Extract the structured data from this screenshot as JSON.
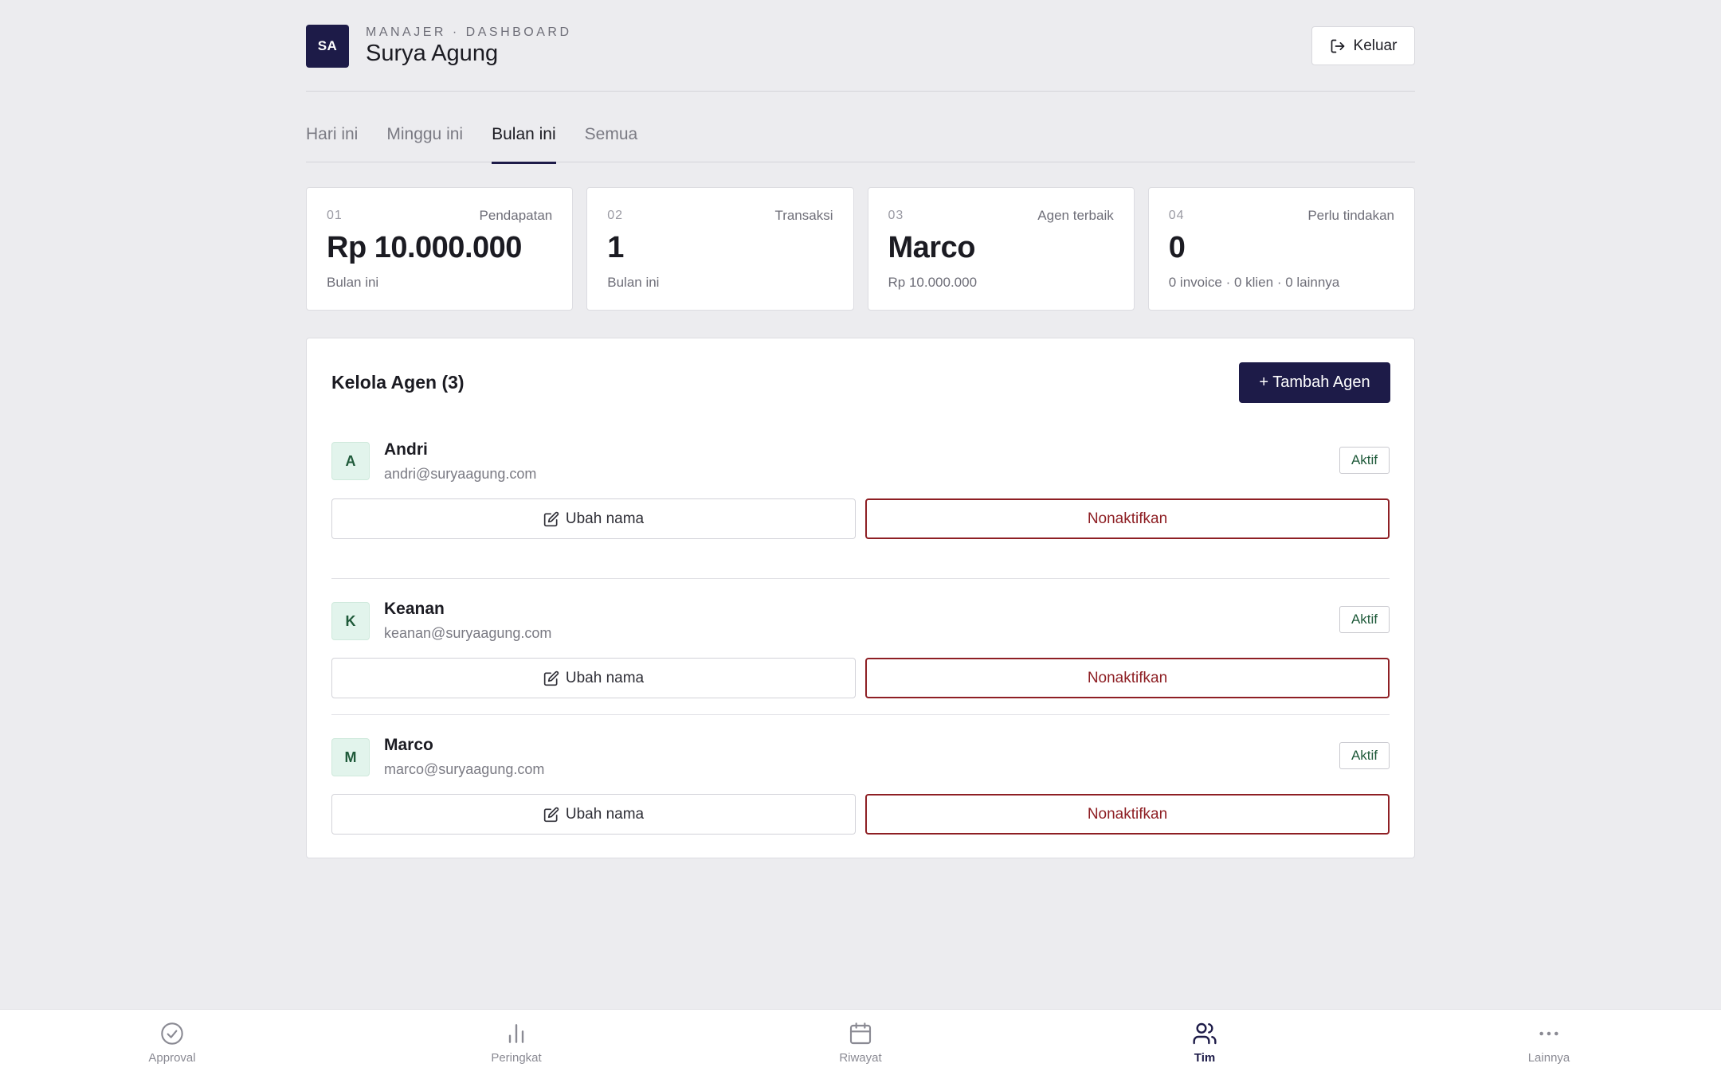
{
  "header": {
    "avatar_initials": "SA",
    "eyebrow": "MANAJER · DASHBOARD",
    "title": "Surya Agung",
    "logout_label": "Keluar",
    "logout_icon": "logout-icon"
  },
  "tabs": [
    {
      "label": "Hari ini",
      "active": false
    },
    {
      "label": "Minggu ini",
      "active": false
    },
    {
      "label": "Bulan ini",
      "active": true
    },
    {
      "label": "Semua",
      "active": false
    }
  ],
  "stats": [
    {
      "num": "01",
      "label": "Pendapatan",
      "value": "Rp 10.000.000",
      "sub": "Bulan ini"
    },
    {
      "num": "02",
      "label": "Transaksi",
      "value": "1",
      "sub": "Bulan ini"
    },
    {
      "num": "03",
      "label": "Agen terbaik",
      "value": "Marco",
      "sub": "Rp 10.000.000"
    },
    {
      "num": "04",
      "label": "Perlu tindakan",
      "value": "0",
      "sub": "0 invoice · 0 klien · 0 lainnya"
    }
  ],
  "agents_panel": {
    "title": "Kelola Agen (3)",
    "add_label": "+ Tambah Agen",
    "edit_label": "Ubah nama",
    "deactivate_label": "Nonaktifkan",
    "agents": [
      {
        "initial": "A",
        "name": "Andri",
        "email": "andri@suryaagung.com",
        "status": "Aktif"
      },
      {
        "initial": "K",
        "name": "Keanan",
        "email": "keanan@suryaagung.com",
        "status": "Aktif"
      },
      {
        "initial": "M",
        "name": "Marco",
        "email": "marco@suryaagung.com",
        "status": "Aktif"
      }
    ]
  },
  "bottom_nav": [
    {
      "label": "Approval",
      "icon": "check-circle-icon",
      "active": false
    },
    {
      "label": "Peringkat",
      "icon": "bar-chart-icon",
      "active": false
    },
    {
      "label": "Riwayat",
      "icon": "calendar-icon",
      "active": false
    },
    {
      "label": "Tim",
      "icon": "users-icon",
      "active": true
    },
    {
      "label": "Lainnya",
      "icon": "more-horizontal-icon",
      "active": false
    }
  ],
  "colors": {
    "background": "#ececef",
    "primary": "#1d1b48",
    "danger": "#8e1f24",
    "success_text": "#1f5a3a",
    "avatar_bg": "#e2f4ec"
  }
}
